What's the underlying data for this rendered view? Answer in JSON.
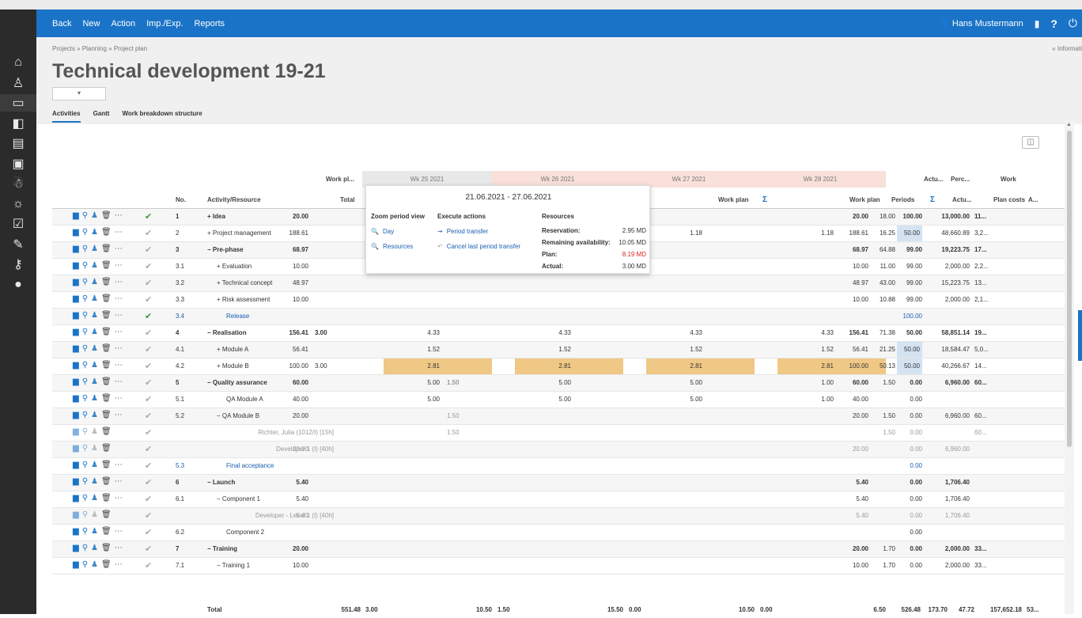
{
  "sidebar": {
    "icons": [
      "home-icon",
      "user-icon",
      "folder-icon",
      "toggle-icon",
      "chart-folder-icon",
      "image-folder-icon",
      "team-icon",
      "bug-icon",
      "checkbox-icon",
      "tag-icon",
      "key-icon",
      "circle-icon"
    ]
  },
  "navbar": {
    "back": "Back",
    "new": "New",
    "action": "Action",
    "import_export": "Imp./Exp.",
    "reports": "Reports",
    "user": "Hans Mustermann",
    "help": "?"
  },
  "breadcrumb": "Projects » Planning » Project plan",
  "info_link": "« Informati",
  "title": "Technical development 19-21",
  "tabs": [
    "Activities",
    "Gantt",
    "Work breakdown structure"
  ],
  "headers": {
    "work_pl": "Work pl...",
    "no": "No.",
    "activity": "Activity/Resource",
    "total": "Total",
    "wk25": "Wk 25 2021",
    "wk26": "Wk 26 2021",
    "wk27": "Wk 27 2021",
    "wk28": "Wk 28 2021",
    "workplan": "Work plan",
    "sigma": "Σ",
    "periods": "Periods",
    "actu": "Actu...",
    "perc": "Perc...",
    "actu2": "Actu...",
    "work": "Work",
    "plan_costs": "Plan costs",
    "a": "A..."
  },
  "rows": [
    {
      "no": "1",
      "name": "+ Idea",
      "level": 0,
      "bold": true,
      "check": "green",
      "total": "20.00",
      "periods": "20.00",
      "actual": "18.00",
      "perc": "100.00",
      "cost": "13,000.00",
      "a": "11..."
    },
    {
      "no": "2",
      "name": "+ Project management",
      "level": 0,
      "bold": false,
      "total": "188.61",
      "w27": "1.18",
      "w28": "1.18",
      "periods": "188.61",
      "actual": "16.25",
      "perc": "50.00",
      "perc_blue": true,
      "cost": "48,660.89",
      "a": "3,2..."
    },
    {
      "no": "3",
      "name": "− Pre-phase",
      "level": 0,
      "bold": true,
      "total": "68.97",
      "periods": "68.97",
      "actual": "64.88",
      "perc": "99.00",
      "cost": "19,223.75",
      "a": "17..."
    },
    {
      "no": "3.1",
      "name": "+ Evaluation",
      "level": 1,
      "total": "10.00",
      "periods": "10.00",
      "actual": "11.00",
      "perc": "99.00",
      "cost": "2,000.00",
      "a": "2,2..."
    },
    {
      "no": "3.2",
      "name": "+ Technical concept",
      "level": 1,
      "total": "48.97",
      "periods": "48.97",
      "actual": "43.00",
      "perc": "99.00",
      "cost": "15,223.75",
      "a": "13..."
    },
    {
      "no": "3.3",
      "name": "+ Risk assessment",
      "level": 1,
      "total": "10.00",
      "periods": "10.00",
      "actual": "10.88",
      "perc": "99.00",
      "cost": "2,000.00",
      "a": "2,1..."
    },
    {
      "no": "3.4",
      "name": "Release",
      "level": 2,
      "link": true,
      "check": "green",
      "perc": "100.00",
      "perc_link": true
    },
    {
      "no": "4",
      "name": "− Realisation",
      "level": 0,
      "bold": true,
      "total": "156.41",
      "w25a": "3.00",
      "w25": "4.33",
      "w26": "4.33",
      "w27": "4.33",
      "w28": "4.33",
      "periods": "156.41",
      "actual": "71.38",
      "perc": "50.00",
      "cost": "58,851.14",
      "a": "19..."
    },
    {
      "no": "4.1",
      "name": "+ Module A",
      "level": 1,
      "total": "56.41",
      "w25": "1.52",
      "w26": "1.52",
      "w27": "1.52",
      "w28": "1.52",
      "periods": "56.41",
      "actual": "21.25",
      "perc": "50.00",
      "perc_blue": true,
      "cost": "18,584.47",
      "a": "5,0..."
    },
    {
      "no": "4.2",
      "name": "+ Module B",
      "level": 1,
      "total": "100.00",
      "w25a": "3.00",
      "w25": "2.81",
      "w26": "2.81",
      "w27": "2.81",
      "w28": "2.81",
      "orange": true,
      "periods": "100.00",
      "actual": "50.13",
      "perc": "50.00",
      "perc_blue": true,
      "cost": "40,266.67",
      "a": "14..."
    },
    {
      "no": "5",
      "name": "− Quality assurance",
      "level": 0,
      "bold": true,
      "total": "60.00",
      "w25": "5.00",
      "w26a": "1.50",
      "w26": "5.00",
      "w27": "5.00",
      "w28": "1.00",
      "periods": "60.00",
      "actual": "1.50",
      "perc": "0.00",
      "cost": "6,960.00",
      "a": "60..."
    },
    {
      "no": "5.1",
      "name": "QA Module A",
      "level": 2,
      "total": "40.00",
      "w25": "5.00",
      "w26": "5.00",
      "w27": "5.00",
      "w28": "1.00",
      "periods": "40.00",
      "perc": "0.00"
    },
    {
      "no": "5.2",
      "name": "− QA Module B",
      "level": 1,
      "total": "20.00",
      "w26a": "1.50",
      "periods": "20.00",
      "actual": "1.50",
      "perc": "0.00",
      "cost": "6,960.00",
      "a": "60..."
    },
    {
      "no": "",
      "name": "Richter, Julia (1012/I) [15h]",
      "level": 3,
      "grey": true,
      "icons": 4,
      "w26a": "1.50",
      "actual": "1.50",
      "perc": "0.00",
      "a": "60..."
    },
    {
      "no": "",
      "name": "Developer 1 (I) [40h]",
      "level": 3,
      "grey": true,
      "icons": 4,
      "total": "20.00",
      "periods": "20.00",
      "perc": "0.00",
      "cost": "6,960.00"
    },
    {
      "no": "5.3",
      "name": "Final acceptance",
      "level": 2,
      "link": true,
      "perc": "0.00",
      "perc_link": true
    },
    {
      "no": "6",
      "name": "− Launch",
      "level": 0,
      "bold": true,
      "total": "5.40",
      "periods": "5.40",
      "perc": "0.00",
      "cost": "1,706.40"
    },
    {
      "no": "6.1",
      "name": "− Component 1",
      "level": 1,
      "total": "5.40",
      "periods": "5.40",
      "perc": "0.00",
      "cost": "1,706.40"
    },
    {
      "no": "",
      "name": "Developer - Level 1 (I) [40h]",
      "level": 3,
      "grey": true,
      "icons": 4,
      "total": "5.40",
      "periods": "5.40",
      "perc": "0.00",
      "cost": "1,706.40"
    },
    {
      "no": "6.2",
      "name": "Component 2",
      "level": 2,
      "perc": "0.00"
    },
    {
      "no": "7",
      "name": "− Training",
      "level": 0,
      "bold": true,
      "total": "20.00",
      "periods": "20.00",
      "actual": "1.70",
      "perc": "0.00",
      "cost": "2,000.00",
      "a": "33..."
    },
    {
      "no": "7.1",
      "name": "− Training 1",
      "level": 1,
      "total": "10.00",
      "periods": "10.00",
      "actual": "1.70",
      "perc": "0.00",
      "cost": "2,000.00",
      "a": "33..."
    }
  ],
  "totals": {
    "label": "Total",
    "total": "551.48",
    "w25a": "3.00",
    "w25": "10.50",
    "w26a": "1.50",
    "w26": "15.50",
    "w27a": "0.00",
    "w27": "10.50",
    "w28a": "0.00",
    "w28": "6.50",
    "periods": "526.48",
    "actual": "173.70",
    "perc": "47.72",
    "cost": "157,652.18",
    "a": "53..."
  },
  "popup": {
    "range": "21.06.2021 - 27.06.2021",
    "zoom_h": "Zoom period view",
    "exec_h": "Execute actions",
    "res_h": "Resources",
    "day": "Day",
    "resources": "Resources",
    "period_transfer": "Period transfer",
    "cancel": "Cancel last period transfer",
    "reservation_l": "Reservation:",
    "reservation_v": "2.95 MD",
    "remaining_l": "Remaining availability:",
    "remaining_v": "10.05 MD",
    "plan_l": "Plan:",
    "plan_v": "8.19 MD",
    "actual_l": "Actual:",
    "actual_v": "3.00 MD",
    "plan_color": "#e02020"
  },
  "colors": {
    "nav": "#1a73c7",
    "sidebar": "#2b2b2b",
    "week_gray": "#e8e8e8",
    "week_pink": "#f9e0d9",
    "orange": "#f0c885",
    "highlight_blue": "#d4e3f1"
  }
}
